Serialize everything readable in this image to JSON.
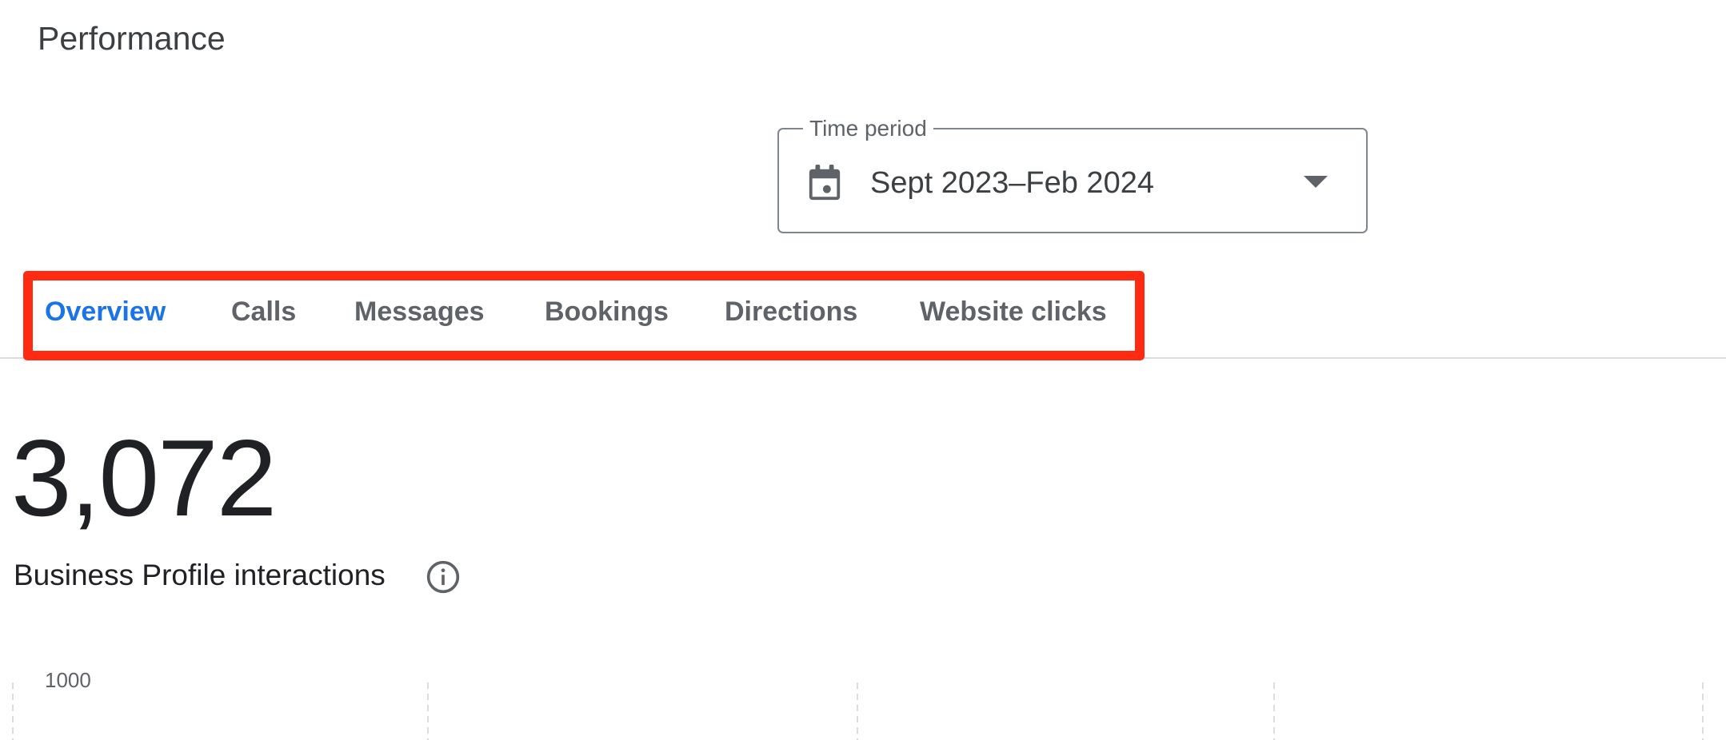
{
  "page": {
    "title": "Performance"
  },
  "time_period": {
    "label": "Time period",
    "value": "Sept 2023–Feb 2024",
    "icon": "calendar-icon",
    "dropdown_icon": "arrow-drop-down-icon"
  },
  "tabs": [
    {
      "label": "Overview",
      "active": true
    },
    {
      "label": "Calls",
      "active": false
    },
    {
      "label": "Messages",
      "active": false
    },
    {
      "label": "Bookings",
      "active": false
    },
    {
      "label": "Directions",
      "active": false
    },
    {
      "label": "Website clicks",
      "active": false
    }
  ],
  "metric": {
    "value": "3,072",
    "label": "Business Profile interactions",
    "info_icon": "info-icon"
  },
  "chart": {
    "y_tick_top": "1000"
  },
  "colors": {
    "active_tab": "#1a73e8",
    "highlight": "#ff2a12",
    "text_primary": "#202124",
    "text_secondary": "#5f6368"
  }
}
